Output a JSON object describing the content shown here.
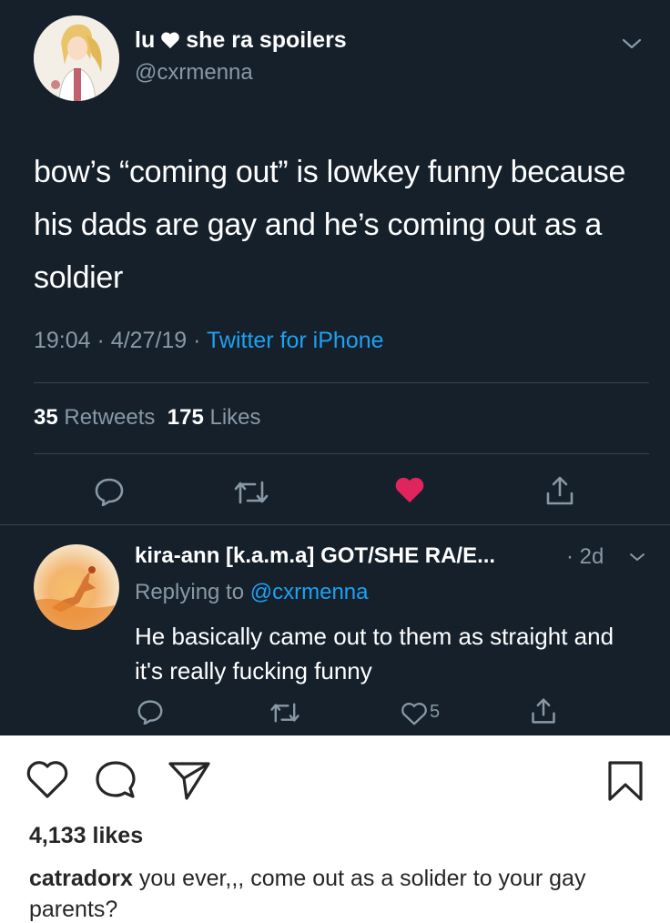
{
  "tweet": {
    "display_name_left": "lu",
    "display_name_right": "she ra spoilers",
    "handle": "@cxrmenna",
    "text": "bow’s “coming out” is lowkey funny because his dads are gay and he’s coming out as a soldier",
    "time": "19:04",
    "date": "4/27/19",
    "source": "Twitter for iPhone",
    "retweets_count": "35",
    "retweets_label": "Retweets",
    "likes_count": "175",
    "likes_label": "Likes",
    "liked": true,
    "colors": {
      "background": "#15202b",
      "muted": "#8899a6",
      "link": "#1da1f2",
      "like": "#e0245e"
    }
  },
  "reply": {
    "display_name": "kira-ann [k.a.m.a] GOT/SHE RA/E...",
    "time": "2d",
    "replying_prefix": "Replying to",
    "replying_to": "@cxrmenna",
    "text": "He basically came out to them as straight and it's really fucking funny",
    "like_count": "5"
  },
  "instagram": {
    "likes": "4,133 likes",
    "caption_user": "catradorx",
    "caption_text": "you ever,,, come out as a solider to your gay parents?",
    "icons": [
      "heart-icon",
      "comment-icon",
      "share-icon",
      "bookmark-icon"
    ]
  }
}
